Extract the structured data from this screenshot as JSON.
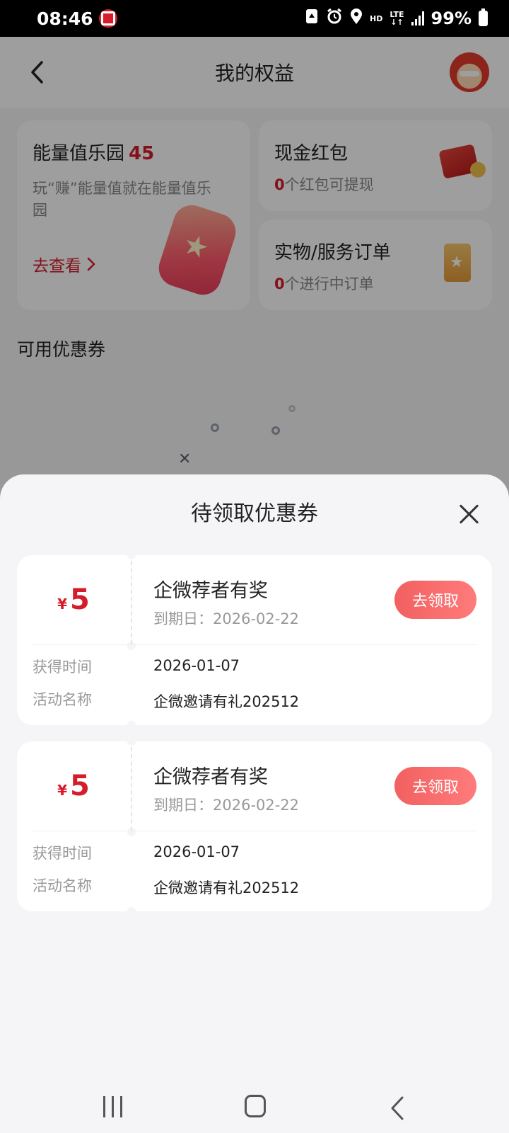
{
  "status_bar": {
    "time": "08:46",
    "hd": "HD",
    "lte": "LTE",
    "battery": "99%"
  },
  "header": {
    "title": "我的权益"
  },
  "energy_card": {
    "title": "能量值乐园",
    "value": "45",
    "description": "玩“赚”能量值就在能量值乐园",
    "link": "去查看"
  },
  "cash_card": {
    "title": "现金红包",
    "count": "0",
    "suffix": "个红包可提现"
  },
  "orders_card": {
    "title": "实物/服务订单",
    "count": "0",
    "suffix": "个进行中订单"
  },
  "section": {
    "available_coupons": "可用优惠券"
  },
  "sheet": {
    "title": "待领取优惠券",
    "coupons": [
      {
        "currency": "¥",
        "amount": "5",
        "name": "企微荐者有奖",
        "expiry": "到期日：2026-02-22",
        "claim_label": "去领取",
        "obtained_label": "获得时间",
        "obtained_value": "2026-01-07",
        "activity_label": "活动名称",
        "activity_value": "企微邀请有礼202512"
      },
      {
        "currency": "¥",
        "amount": "5",
        "name": "企微荐者有奖",
        "expiry": "到期日：2026-02-22",
        "claim_label": "去领取",
        "obtained_label": "获得时间",
        "obtained_value": "2026-01-07",
        "activity_label": "活动名称",
        "activity_value": "企微邀请有礼202512"
      }
    ]
  },
  "colors": {
    "accent": "#d51c2a",
    "button": "#f26060"
  },
  "icons": {
    "back": "chevron-left-icon",
    "close": "close-icon",
    "mascot": "mascot-avatar",
    "energy": "jar-star-icon",
    "cash": "red-packet-icon",
    "orders": "order-bag-icon"
  }
}
